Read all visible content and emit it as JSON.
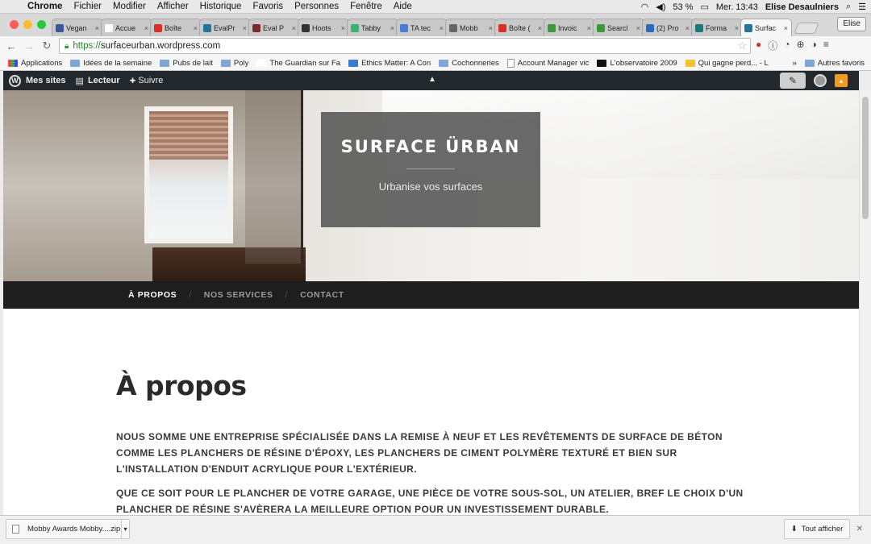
{
  "menubar": {
    "apple": "",
    "items": [
      "Chrome",
      "Fichier",
      "Modifier",
      "Afficher",
      "Historique",
      "Favoris",
      "Personnes",
      "Fenêtre",
      "Aide"
    ],
    "battery": "53 %",
    "clock": "Mer. 13:43",
    "user": "Elise Desaulniers"
  },
  "tabs": [
    {
      "label": "Vegan",
      "color": "#3b5998"
    },
    {
      "label": "Accue",
      "color": "#ffffff"
    },
    {
      "label": "Boîte",
      "color": "#d93025"
    },
    {
      "label": "EvalPr",
      "color": "#21759b"
    },
    {
      "label": "Eval P",
      "color": "#7a2a2a"
    },
    {
      "label": "Hoots",
      "color": "#333333"
    },
    {
      "label": "Tabby",
      "color": "#3bb273"
    },
    {
      "label": "TA tec",
      "color": "#4a7bd6"
    },
    {
      "label": "Mobb",
      "color": "#666666"
    },
    {
      "label": "Boîte (",
      "color": "#d93025"
    },
    {
      "label": "Invoic",
      "color": "#3a9a3a"
    },
    {
      "label": "Searcl",
      "color": "#3a9a3a"
    },
    {
      "label": "(2) Pro",
      "color": "#2a6ab8"
    },
    {
      "label": "Forma",
      "color": "#1a7a7a"
    },
    {
      "label": "Surfac",
      "color": "#21759b",
      "active": true
    }
  ],
  "profile": "Elise",
  "toolbar": {
    "url_scheme": "https://",
    "url_host": "surfaceurban.wordpress.com"
  },
  "bookmarks": [
    {
      "label": "Applications",
      "type": "apps"
    },
    {
      "label": "Idées de la semaine",
      "type": "folder"
    },
    {
      "label": "Pubs de lait",
      "type": "folder"
    },
    {
      "label": "Poly",
      "type": "folder"
    },
    {
      "label": "The Guardian sur Fa",
      "type": "g"
    },
    {
      "label": "Ethics Matter: A Con",
      "type": "cc"
    },
    {
      "label": "Cochonneries",
      "type": "folder"
    },
    {
      "label": "Account Manager vic",
      "type": "page"
    },
    {
      "label": "L'observatoire 2009",
      "type": "p"
    },
    {
      "label": "Qui gagne perd... - L",
      "type": "q"
    }
  ],
  "bookmarks_more": "»",
  "bookmarks_other": "Autres favoris",
  "wpbar": {
    "my_sites": "Mes sites",
    "reader": "Lecteur",
    "follow": "Suivre"
  },
  "site": {
    "title": "SURFACE ÜRBAN",
    "tagline": "Urbanise vos surfaces",
    "nav": [
      {
        "label": "À PROPOS",
        "active": true
      },
      {
        "label": "NOS SERVICES",
        "active": false
      },
      {
        "label": "CONTACT",
        "active": false
      }
    ],
    "nav_sep": "/"
  },
  "page": {
    "heading": "À propos",
    "para1": "NOUS SOMME UNE ENTREPRISE SPÉCIALISÉE DANS LA REMISE À NEUF ET LES REVÊTEMENTS DE SURFACE DE BÉTON COMME LES PLANCHERS DE RÉSINE D'ÉPOXY, LES PLANCHERS DE CIMENT POLYMÈRE TEXTURÉ ET BIEN SUR L'INSTALLATION D'ENDUIT ACRYLIQUE  POUR L'EXTÉRIEUR.",
    "para2": "QUE CE SOIT POUR LE PLANCHER DE VOTRE GARAGE, UNE PIÈCE DE VOTRE SOUS-SOL, UN ATELIER, BREF LE CHOIX D'UN PLANCHER DE RÉSINE S'AVÈRERA LA MEILLEURE OPTION POUR UN INVESTISSEMENT DURABLE."
  },
  "downloads": {
    "file": "Mobby Awards Mobby....zip",
    "show_all": "Tout afficher"
  }
}
